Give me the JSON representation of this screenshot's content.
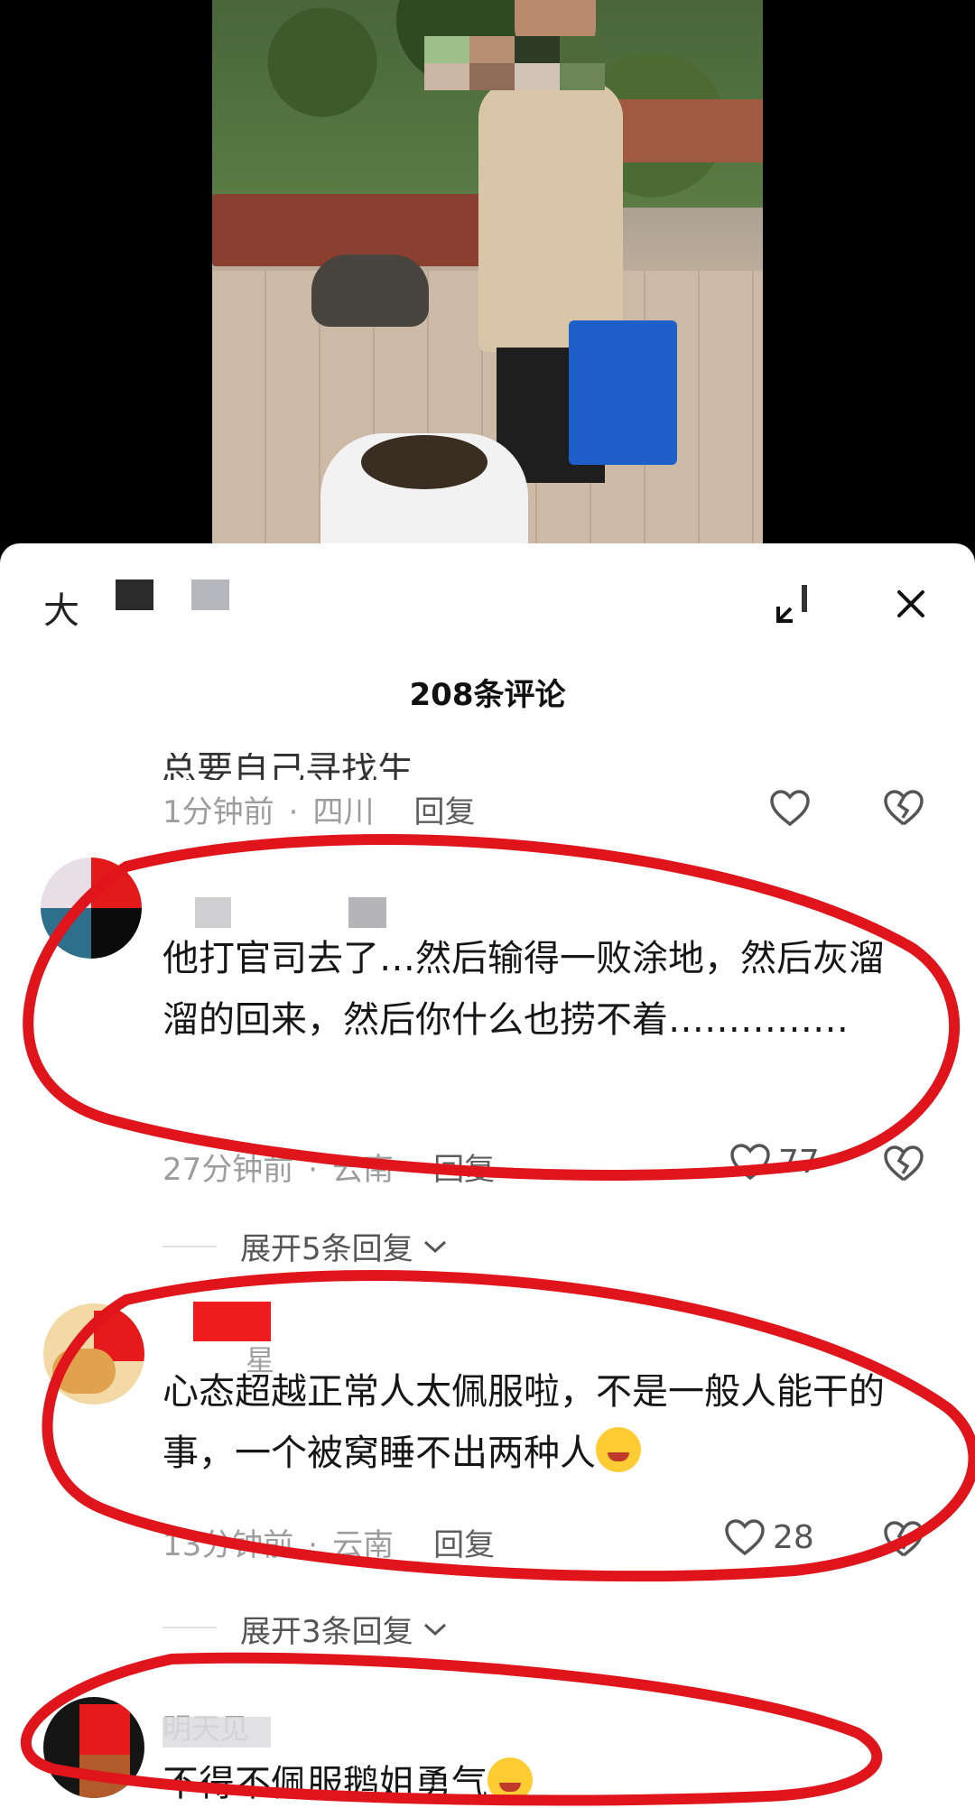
{
  "header": {
    "author_name": "大"
  },
  "comments_title": "208条评论",
  "comments": [
    {
      "id": "c0",
      "partial_text": "总要自己寻找生",
      "time": "1分钟前",
      "location": "四川",
      "reply_label": "回复",
      "likes": ""
    },
    {
      "id": "c1",
      "text": "他打官司去了…然后输得一败涂地，然后灰溜溜的回来，然后你什么也捞不着……………",
      "time": "27分钟前",
      "location": "云南",
      "reply_label": "回复",
      "likes": "77",
      "expand_label": "展开5条回复"
    },
    {
      "id": "c2",
      "nickname": "星",
      "text": "心态超越正常人太佩服啦，不是一般人能干的事，一个被窝睡不出两种人",
      "emoji": "rolling-laughing-emoji",
      "time": "13分钟前",
      "location": "云南",
      "reply_label": "回复",
      "likes": "28",
      "expand_label": "展开3条回复"
    },
    {
      "id": "c3",
      "nickname": "明天见",
      "text": "不得不佩服鹅姐勇气",
      "emoji": "shushing-face-emoji"
    }
  ],
  "colors": {
    "annotation_red": "#e0141b",
    "sheet_bg": "#ffffff",
    "meta_gray": "#9d9d9d"
  },
  "icons": [
    "expand-icon",
    "close-icon",
    "heart-icon",
    "broken-heart-icon",
    "chevron-down-icon"
  ]
}
